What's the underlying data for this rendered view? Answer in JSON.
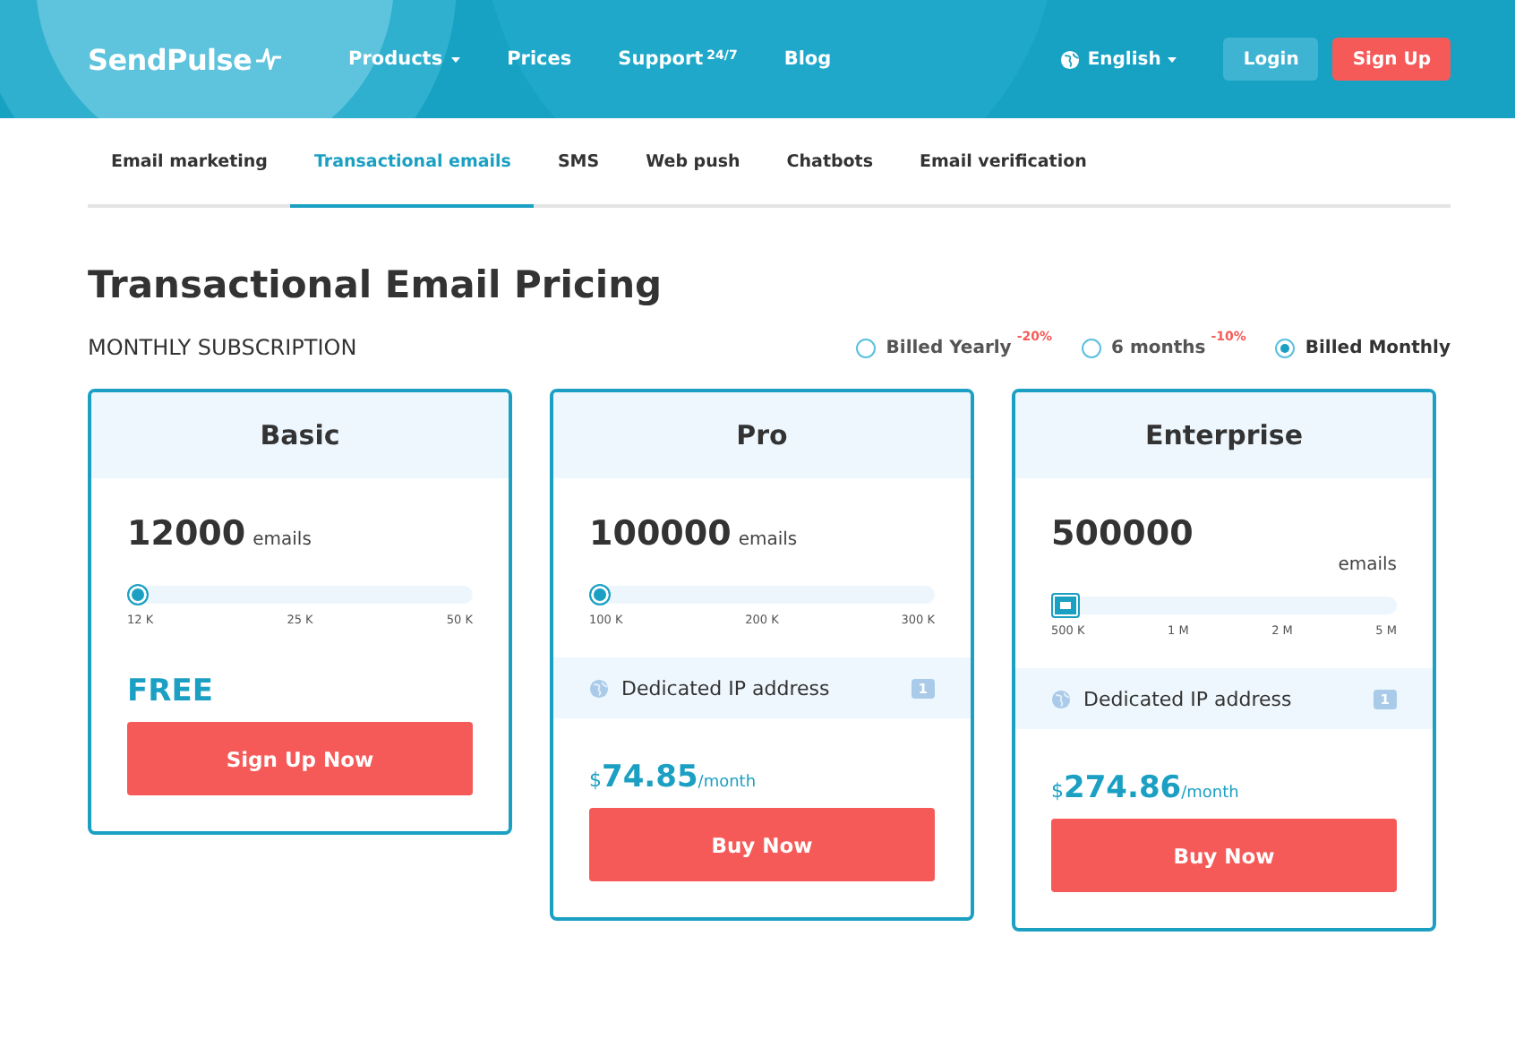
{
  "header": {
    "logo": "SendPulse",
    "nav": [
      {
        "label": "Products",
        "dropdown": true
      },
      {
        "label": "Prices",
        "dropdown": false
      },
      {
        "label": "Support",
        "sup": "24/7",
        "dropdown": false
      },
      {
        "label": "Blog",
        "dropdown": false
      }
    ],
    "language": "English",
    "login": "Login",
    "signup": "Sign Up"
  },
  "tabs": [
    {
      "label": "Email marketing",
      "selected": false
    },
    {
      "label": "Transactional emails",
      "selected": true
    },
    {
      "label": "SMS",
      "selected": false
    },
    {
      "label": "Web push",
      "selected": false
    },
    {
      "label": "Chatbots",
      "selected": false
    },
    {
      "label": "Email verification",
      "selected": false
    }
  ],
  "title": "Transactional Email Pricing",
  "subscription_label": "MONTHLY SUBSCRIPTION",
  "billing": [
    {
      "label": "Billed Yearly",
      "discount": "-20%",
      "selected": false
    },
    {
      "label": "6 months",
      "discount": "-10%",
      "selected": false
    },
    {
      "label": "Billed Monthly",
      "selected": true
    }
  ],
  "plans": [
    {
      "kind": "standard",
      "name": "Basic",
      "count": "12000",
      "unit": "emails",
      "level": 0,
      "ticks": [
        "12 K",
        "25 K",
        "50 K"
      ],
      "price": {
        "kind": "free",
        "text": "FREE"
      },
      "button": "Sign Up Now"
    },
    {
      "kind": "standard",
      "name": "Pro",
      "count": "100000",
      "unit": "emails",
      "level": 0,
      "ticks": [
        "100 K",
        "200 K",
        "300 K"
      ],
      "feature": {
        "label": "Dedicated IP address",
        "count": "1"
      },
      "price": {
        "kind": "paid",
        "currency": "$",
        "amount": "74.85",
        "period": "/month"
      },
      "button": "Buy Now"
    },
    {
      "kind": "enterprise",
      "name": "Enterprise",
      "count": "500000",
      "unit": "emails",
      "level": 0,
      "ticks": [
        "500 K",
        "1 M",
        "2 M",
        "5 M"
      ],
      "feature": {
        "label": "Dedicated IP address",
        "count": "1"
      },
      "price": {
        "kind": "paid",
        "currency": "$",
        "amount": "274.86",
        "period": "/month"
      },
      "button": "Buy Now"
    }
  ]
}
